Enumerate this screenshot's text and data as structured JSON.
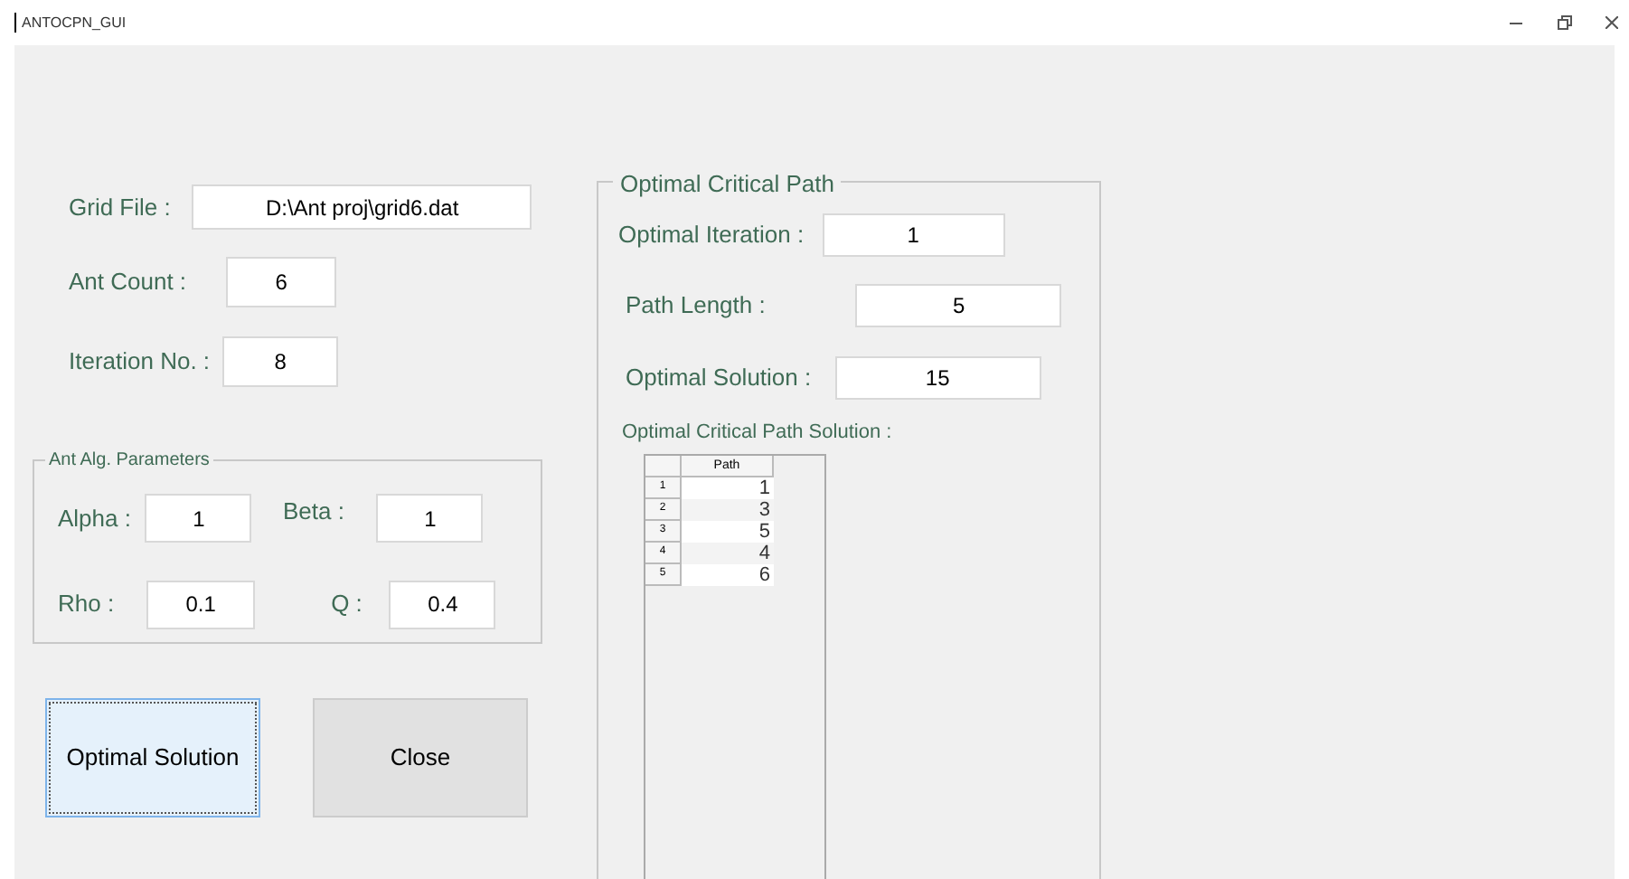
{
  "window": {
    "title": "ANTOCPN_GUI"
  },
  "inputs": {
    "grid_file": {
      "label": "Grid File :",
      "value": "D:\\Ant proj\\grid6.dat"
    },
    "ant_count": {
      "label": "Ant Count :",
      "value": "6"
    },
    "iteration_no": {
      "label": "Iteration No. :",
      "value": "8"
    }
  },
  "parameters": {
    "title": "Ant Alg. Parameters",
    "alpha": {
      "label": "Alpha :",
      "value": "1"
    },
    "beta": {
      "label": "Beta :",
      "value": "1"
    },
    "rho": {
      "label": "Rho :",
      "value": "0.1"
    },
    "q": {
      "label": "Q :",
      "value": "0.4"
    }
  },
  "buttons": [
    {
      "label": "Optimal Solution",
      "selected": true
    },
    {
      "label": "Close",
      "selected": false
    }
  ],
  "result": {
    "title": "Optimal Critical Path",
    "optimal_iteration": {
      "label": "Optimal Iteration :",
      "value": "1"
    },
    "path_length": {
      "label": "Path Length :",
      "value": "5"
    },
    "optimal_solution": {
      "label": "Optimal Solution :",
      "value": "15"
    },
    "table_label": "Optimal Critical Path Solution :",
    "table": {
      "column": "Path",
      "rows": [
        {
          "index": "1",
          "value": "1"
        },
        {
          "index": "2",
          "value": "3"
        },
        {
          "index": "3",
          "value": "5"
        },
        {
          "index": "4",
          "value": "4"
        },
        {
          "index": "5",
          "value": "6"
        }
      ]
    }
  }
}
